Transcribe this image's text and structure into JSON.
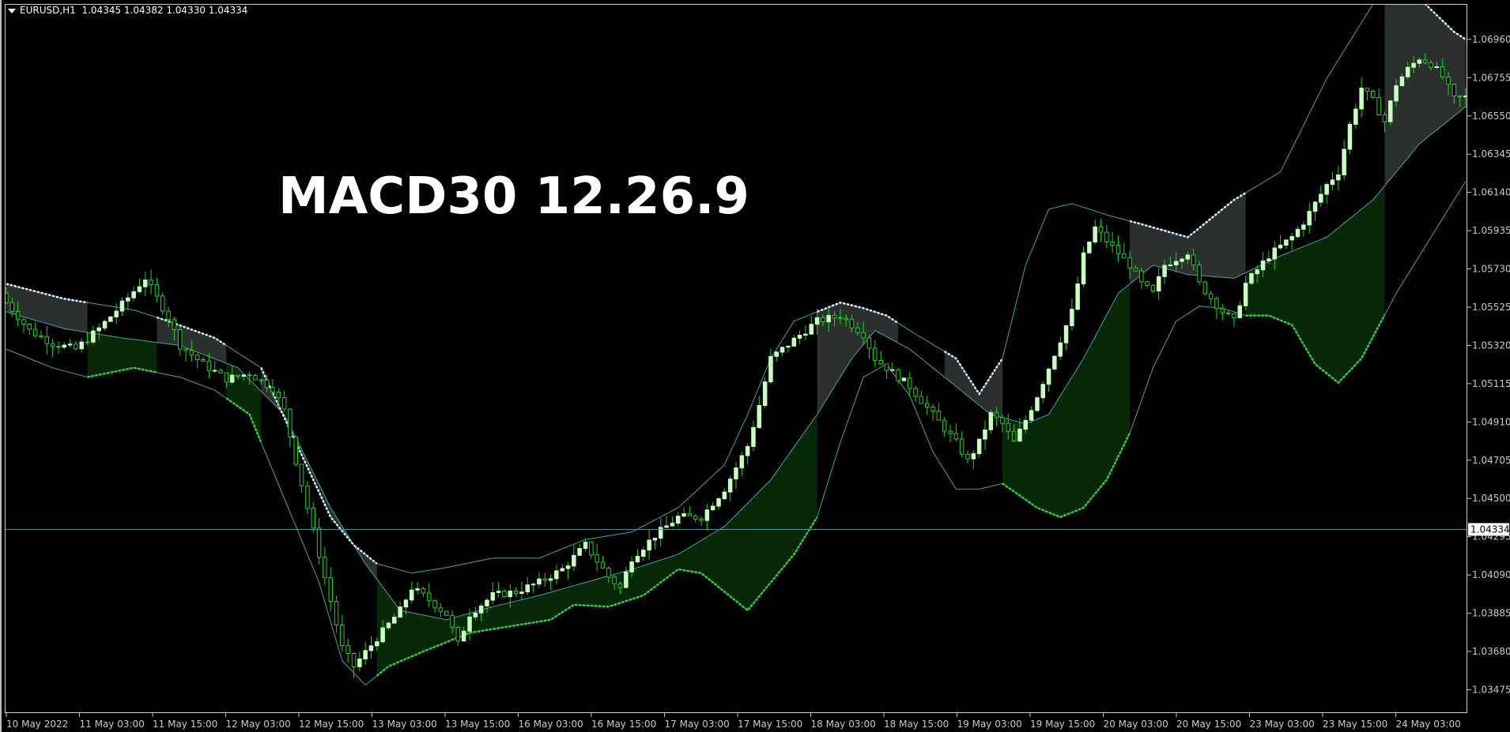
{
  "header": {
    "symbol": "EURUSD,H1",
    "ohlc": "1.04345 1.04382 1.04330 1.04334"
  },
  "overlay_title": "MACD30 12.26.9",
  "price_marker": "1.04334",
  "colors": {
    "background": "#000000",
    "bull_candle": "#c8ffc0",
    "bear_candle": "#1fd31f",
    "band_line": "#3aa6a6",
    "upper_fill": "#2b302e",
    "lower_fill": "#062806",
    "lower_dots": "#22e022",
    "upper_dots": "#e8eff6",
    "price_line": "#4f8b96",
    "axis": "#c8c8c8"
  },
  "chart_data": {
    "type": "candlestick",
    "symbol": "EURUSD",
    "timeframe": "H1",
    "ylim": [
      1.0335,
      1.0715
    ],
    "y_ticks": [
      "1.06960",
      "1.06755",
      "1.06550",
      "1.06345",
      "1.06140",
      "1.05935",
      "1.05730",
      "1.05525",
      "1.05320",
      "1.05115",
      "1.04910",
      "1.04705",
      "1.04500",
      "1.04295",
      "1.04090",
      "1.03885",
      "1.03680",
      "1.03475"
    ],
    "x_ticks": [
      "10 May 2022",
      "11 May 03:00",
      "11 May 15:00",
      "12 May 03:00",
      "12 May 15:00",
      "13 May 03:00",
      "13 May 15:00",
      "16 May 03:00",
      "16 May 15:00",
      "17 May 03:00",
      "17 May 15:00",
      "18 May 03:00",
      "18 May 15:00",
      "19 May 03:00",
      "19 May 15:00",
      "20 May 03:00",
      "20 May 15:00",
      "23 May 03:00",
      "23 May 15:00",
      "24 May 03:00"
    ],
    "last_price": 1.04334,
    "close_path": [
      [
        0,
        1.0555
      ],
      [
        4,
        1.054
      ],
      [
        8,
        1.0533
      ],
      [
        12,
        1.053
      ],
      [
        16,
        1.0541
      ],
      [
        20,
        1.0554
      ],
      [
        24,
        1.0568
      ],
      [
        28,
        1.0547
      ],
      [
        30,
        1.0532
      ],
      [
        34,
        1.0522
      ],
      [
        38,
        1.0514
      ],
      [
        42,
        1.0517
      ],
      [
        46,
        1.0509
      ],
      [
        48,
        1.0497
      ],
      [
        50,
        1.047
      ],
      [
        52,
        1.0445
      ],
      [
        54,
        1.042
      ],
      [
        56,
        1.0395
      ],
      [
        58,
        1.037
      ],
      [
        60,
        1.036
      ],
      [
        64,
        1.0375
      ],
      [
        68,
        1.039
      ],
      [
        70,
        1.0402
      ],
      [
        72,
        1.0398
      ],
      [
        76,
        1.0388
      ],
      [
        78,
        1.0372
      ],
      [
        80,
        1.0388
      ],
      [
        84,
        1.0398
      ],
      [
        88,
        1.04
      ],
      [
        92,
        1.0405
      ],
      [
        96,
        1.0412
      ],
      [
        100,
        1.0425
      ],
      [
        104,
        1.0408
      ],
      [
        106,
        1.0402
      ],
      [
        108,
        1.0418
      ],
      [
        112,
        1.043
      ],
      [
        116,
        1.044
      ],
      [
        120,
        1.044
      ],
      [
        124,
        1.0455
      ],
      [
        128,
        1.0478
      ],
      [
        130,
        1.05
      ],
      [
        132,
        1.0525
      ],
      [
        136,
        1.0535
      ],
      [
        140,
        1.0545
      ],
      [
        144,
        1.0548
      ],
      [
        148,
        1.0538
      ],
      [
        150,
        1.0525
      ],
      [
        154,
        1.0515
      ],
      [
        156,
        1.051
      ],
      [
        160,
        1.0495
      ],
      [
        164,
        1.048
      ],
      [
        166,
        1.047
      ],
      [
        168,
        1.048
      ],
      [
        170,
        1.0495
      ],
      [
        172,
        1.049
      ],
      [
        174,
        1.048
      ],
      [
        176,
        1.0492
      ],
      [
        178,
        1.0505
      ],
      [
        180,
        1.052
      ],
      [
        184,
        1.055
      ],
      [
        186,
        1.058
      ],
      [
        188,
        1.0595
      ],
      [
        190,
        1.0588
      ],
      [
        194,
        1.0575
      ],
      [
        196,
        1.0565
      ],
      [
        198,
        1.056
      ],
      [
        200,
        1.0575
      ],
      [
        204,
        1.0582
      ],
      [
        206,
        1.0565
      ],
      [
        210,
        1.055
      ],
      [
        212,
        1.0545
      ],
      [
        214,
        1.0565
      ],
      [
        218,
        1.058
      ],
      [
        222,
        1.059
      ],
      [
        224,
        1.0598
      ],
      [
        226,
        1.0608
      ],
      [
        228,
        1.0618
      ],
      [
        230,
        1.0625
      ],
      [
        232,
        1.065
      ],
      [
        234,
        1.067
      ],
      [
        236,
        1.0663
      ],
      [
        238,
        1.0652
      ],
      [
        240,
        1.0672
      ],
      [
        242,
        1.068
      ],
      [
        244,
        1.0686
      ],
      [
        246,
        1.0683
      ],
      [
        248,
        1.0676
      ],
      [
        250,
        1.0664
      ],
      [
        252,
        1.0665
      ]
    ],
    "upper_band_path": [
      [
        0,
        1.0565
      ],
      [
        10,
        1.0557
      ],
      [
        22,
        1.0551
      ],
      [
        28,
        1.0545
      ],
      [
        36,
        1.0536
      ],
      [
        44,
        1.052
      ],
      [
        50,
        1.048
      ],
      [
        56,
        1.044
      ],
      [
        60,
        1.0425
      ],
      [
        64,
        1.0415
      ],
      [
        70,
        1.041
      ],
      [
        76,
        1.0413
      ],
      [
        84,
        1.0418
      ],
      [
        92,
        1.0418
      ],
      [
        100,
        1.0428
      ],
      [
        108,
        1.0432
      ],
      [
        116,
        1.0445
      ],
      [
        124,
        1.0468
      ],
      [
        128,
        1.0495
      ],
      [
        132,
        1.0525
      ],
      [
        136,
        1.0545
      ],
      [
        144,
        1.0555
      ],
      [
        148,
        1.0552
      ],
      [
        152,
        1.0548
      ],
      [
        156,
        1.054
      ],
      [
        164,
        1.0525
      ],
      [
        168,
        1.0506
      ],
      [
        172,
        1.0525
      ],
      [
        176,
        1.0575
      ],
      [
        180,
        1.0605
      ],
      [
        184,
        1.0608
      ],
      [
        190,
        1.0602
      ],
      [
        196,
        1.0597
      ],
      [
        204,
        1.059
      ],
      [
        208,
        1.06
      ],
      [
        212,
        1.061
      ],
      [
        220,
        1.0625
      ],
      [
        228,
        1.0675
      ],
      [
        236,
        1.0715
      ],
      [
        240,
        1.072
      ],
      [
        244,
        1.0718
      ],
      [
        250,
        1.07
      ],
      [
        252,
        1.0696
      ]
    ],
    "middle_band_path": [
      [
        0,
        1.055
      ],
      [
        10,
        1.0541
      ],
      [
        20,
        1.0536
      ],
      [
        30,
        1.0532
      ],
      [
        40,
        1.052
      ],
      [
        48,
        1.0495
      ],
      [
        56,
        1.0445
      ],
      [
        62,
        1.0415
      ],
      [
        68,
        1.039
      ],
      [
        76,
        1.0385
      ],
      [
        84,
        1.0392
      ],
      [
        92,
        1.0398
      ],
      [
        100,
        1.0405
      ],
      [
        108,
        1.0412
      ],
      [
        116,
        1.042
      ],
      [
        124,
        1.0435
      ],
      [
        132,
        1.046
      ],
      [
        140,
        1.0495
      ],
      [
        146,
        1.0525
      ],
      [
        150,
        1.054
      ],
      [
        156,
        1.053
      ],
      [
        164,
        1.051
      ],
      [
        170,
        1.0495
      ],
      [
        176,
        1.049
      ],
      [
        180,
        1.0495
      ],
      [
        186,
        1.0525
      ],
      [
        192,
        1.056
      ],
      [
        198,
        1.0575
      ],
      [
        204,
        1.057
      ],
      [
        212,
        1.0568
      ],
      [
        220,
        1.058
      ],
      [
        228,
        1.059
      ],
      [
        236,
        1.061
      ],
      [
        244,
        1.064
      ],
      [
        250,
        1.0655
      ],
      [
        252,
        1.066
      ]
    ],
    "lower_band_path": [
      [
        0,
        1.053
      ],
      [
        8,
        1.052
      ],
      [
        14,
        1.0515
      ],
      [
        22,
        1.052
      ],
      [
        30,
        1.0515
      ],
      [
        36,
        1.0508
      ],
      [
        42,
        1.0495
      ],
      [
        48,
        1.045
      ],
      [
        54,
        1.0405
      ],
      [
        58,
        1.0363
      ],
      [
        62,
        1.035
      ],
      [
        66,
        1.036
      ],
      [
        72,
        1.0368
      ],
      [
        80,
        1.0378
      ],
      [
        88,
        1.0382
      ],
      [
        94,
        1.0385
      ],
      [
        98,
        1.0393
      ],
      [
        104,
        1.0392
      ],
      [
        110,
        1.0398
      ],
      [
        116,
        1.0412
      ],
      [
        120,
        1.041
      ],
      [
        124,
        1.04
      ],
      [
        128,
        1.039
      ],
      [
        132,
        1.0405
      ],
      [
        136,
        1.042
      ],
      [
        140,
        1.044
      ],
      [
        144,
        1.048
      ],
      [
        148,
        1.0515
      ],
      [
        152,
        1.0522
      ],
      [
        156,
        1.0505
      ],
      [
        160,
        1.0475
      ],
      [
        164,
        1.0455
      ],
      [
        168,
        1.0455
      ],
      [
        172,
        1.0458
      ],
      [
        178,
        1.0445
      ],
      [
        182,
        1.044
      ],
      [
        186,
        1.0445
      ],
      [
        190,
        1.046
      ],
      [
        194,
        1.0485
      ],
      [
        198,
        1.052
      ],
      [
        202,
        1.0545
      ],
      [
        206,
        1.0553
      ],
      [
        210,
        1.0552
      ],
      [
        214,
        1.0548
      ],
      [
        218,
        1.0548
      ],
      [
        222,
        1.0543
      ],
      [
        226,
        1.0522
      ],
      [
        230,
        1.0512
      ],
      [
        234,
        1.0525
      ],
      [
        240,
        1.056
      ],
      [
        246,
        1.059
      ],
      [
        252,
        1.062
      ]
    ],
    "upper_fill_ranges": [
      [
        0,
        14
      ],
      [
        26,
        38
      ],
      [
        44,
        64
      ],
      [
        140,
        154
      ],
      [
        162,
        172
      ],
      [
        194,
        214
      ],
      [
        238,
        252
      ]
    ],
    "lower_fill_ranges": [
      [
        14,
        26
      ],
      [
        38,
        44
      ],
      [
        64,
        140
      ],
      [
        172,
        194
      ],
      [
        214,
        238
      ]
    ]
  }
}
